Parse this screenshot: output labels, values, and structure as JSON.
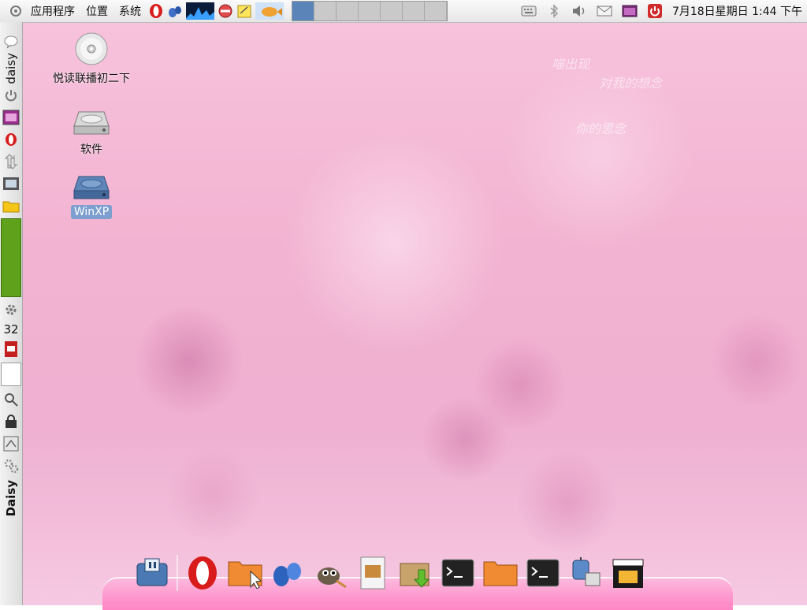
{
  "top_panel": {
    "menus": [
      "应用程序",
      "位置",
      "系统"
    ],
    "clock": "7月18日星期日  1:44 下午",
    "workspaces": [
      {
        "active": true
      },
      {
        "active": false
      },
      {
        "active": false
      },
      {
        "active": false
      },
      {
        "active": false
      },
      {
        "active": false
      },
      {
        "active": false
      }
    ]
  },
  "left_panel": {
    "top_label": "daisy",
    "bottom_label": "Daisy",
    "number": "32"
  },
  "desktop_icons": [
    {
      "label": "悦读联播初二下",
      "icon": "cd-icon"
    },
    {
      "label": "软件",
      "icon": "harddisk-icon"
    },
    {
      "label": "WinXP",
      "icon": "harddisk-blue-icon",
      "selected": true
    }
  ],
  "wallpaper_text": {
    "line1": "喵出现",
    "line2": "对我的想念",
    "line3": "你的思念"
  },
  "colors": {
    "accent": "#5b84b8",
    "wallpaper": "#f2b2d1",
    "dock_shelf": "#ff78be",
    "battery_green": "#5fa11a"
  }
}
